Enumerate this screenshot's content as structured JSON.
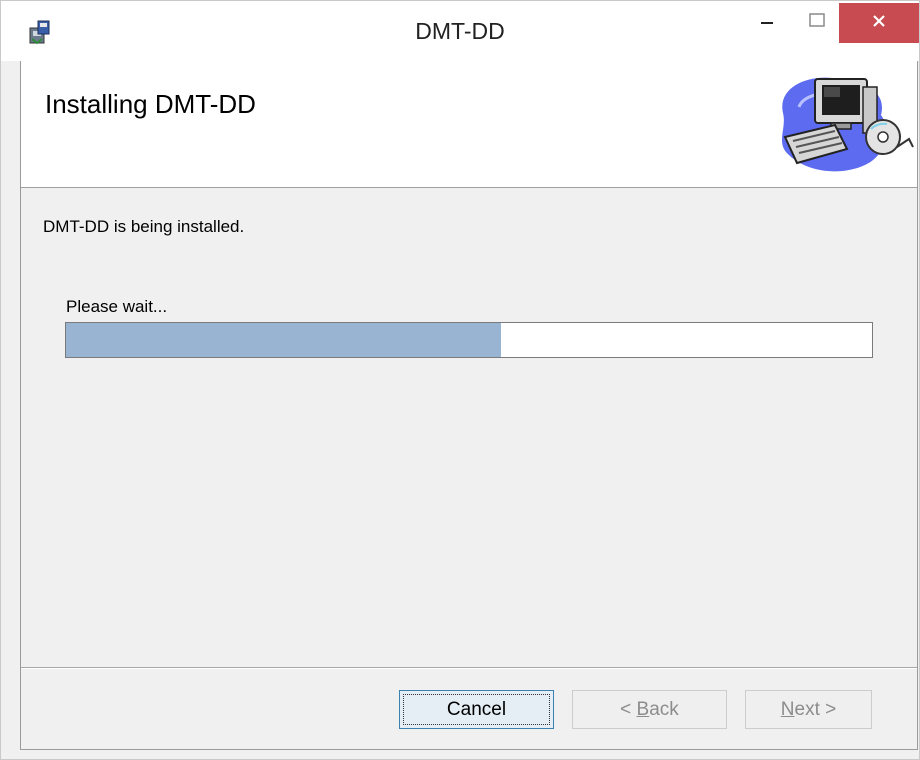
{
  "window": {
    "title": "DMT-DD"
  },
  "banner": {
    "title": "Installing DMT-DD"
  },
  "content": {
    "status": "DMT-DD is being installed.",
    "wait_label": "Please wait...",
    "progress_fraction": 0.54
  },
  "buttons": {
    "cancel": "Cancel",
    "back_prefix": "< ",
    "back_mnemonic": "B",
    "back_rest": "ack",
    "next_mnemonic": "N",
    "next_rest": "ext >"
  },
  "colors": {
    "close_button": "#c74b50",
    "progress_fill": "#98b4d2"
  },
  "icons": {
    "app": "installer-package-icon",
    "minimize": "minimize-icon",
    "maximize": "maximize-icon",
    "close": "close-icon",
    "banner": "computer-setup-graphic"
  }
}
